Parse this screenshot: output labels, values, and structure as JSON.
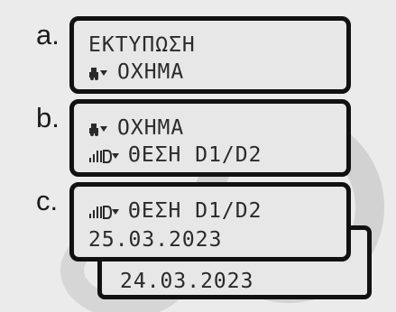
{
  "steps": [
    {
      "label": "a.",
      "line1": "ΕΚΤΥΠΩΣΗ",
      "line2_icon": "printer-truck-icon",
      "line2": "ΟΧΗΜΑ"
    },
    {
      "label": "b.",
      "line1_icon": "printer-truck-icon",
      "line1": "ΟΧΗΜΑ",
      "line2_icon": "speed-profile-printer-icon",
      "line2": "ΘΕΣΗ D1/D2"
    },
    {
      "label": "c.",
      "line1_icon": "speed-profile-printer-icon",
      "line1": "ΘΕΣΗ D1/D2",
      "line2": "25.03.2023",
      "back_line": "24.03.2023"
    }
  ],
  "colors": {
    "lcd_bg": "#e7e7e7",
    "frame": "#111111",
    "watermark": "#cfcfcf"
  }
}
